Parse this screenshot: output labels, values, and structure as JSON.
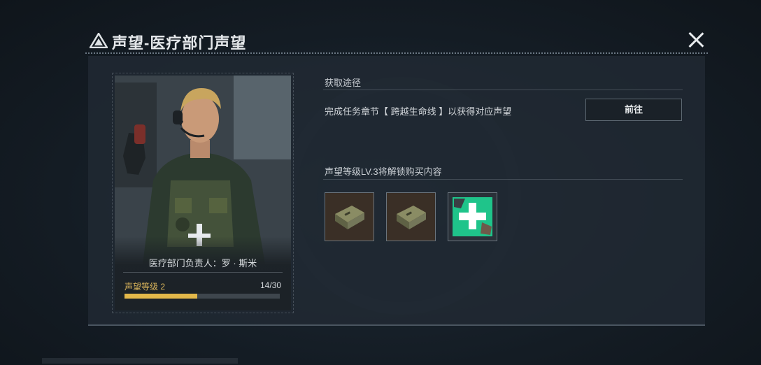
{
  "window": {
    "title": "声望-医疗部门声望"
  },
  "npc": {
    "label": "医疗部门负责人：罗 · 斯米",
    "reputation_level": "声望等级 2",
    "progress_text": "14/30",
    "progress_fraction": 0.467
  },
  "acquire": {
    "heading": "获取途径",
    "task_text": "完成任务章节【 跨越生命线 】以获得对应声望",
    "goto_label": "前往"
  },
  "unlock": {
    "heading": "声望等级LV.3将解锁购买内容",
    "items": [
      {
        "icon": "ammo-crate-icon"
      },
      {
        "icon": "ammo-crate-icon"
      },
      {
        "icon": "medkit-cross-icon"
      }
    ]
  },
  "colors": {
    "accent_gold": "#e3b84a",
    "medical_green": "#1fc48a"
  }
}
